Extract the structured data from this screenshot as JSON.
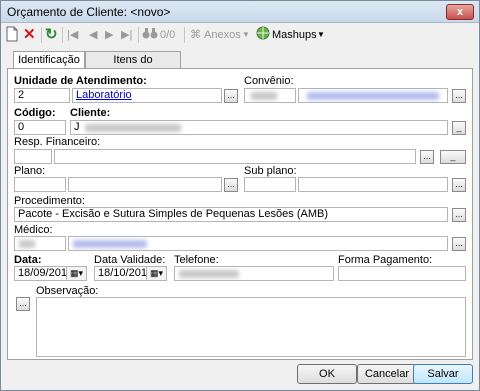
{
  "window": {
    "title": "Orçamento de Cliente: <novo>",
    "close": "x"
  },
  "toolbar": {
    "new_icon": "new-document-icon",
    "delete_icon": "delete-x-icon",
    "refresh_icon": "refresh-icon",
    "first_icon": "first-record-icon",
    "prev_icon": "previous-icon",
    "next_icon": "next-icon",
    "last_icon": "last-record-icon",
    "binoculars_icon": "binoculars-icon",
    "record_count": "0/0",
    "anexos": "Anexos",
    "mashups": "Mashups"
  },
  "tabs": {
    "identificacao": "Identificação",
    "itens": "Itens do Orçamento"
  },
  "form": {
    "unidade": {
      "label": "Unidade de Atendimento:",
      "code": "2",
      "name": "Laboratório"
    },
    "convenio": {
      "label": "Convênio:"
    },
    "codigo": {
      "label": "Código:",
      "value": "0"
    },
    "cliente": {
      "label": "Cliente:",
      "value_prefix": "J"
    },
    "resp_financeiro": {
      "label": "Resp. Financeiro:"
    },
    "plano": {
      "label": "Plano:"
    },
    "sub_plano": {
      "label": "Sub plano:"
    },
    "procedimento": {
      "label": "Procedimento:",
      "value": "Pacote - Excisão e Sutura Simples de Pequenas Lesões (AMB)"
    },
    "medico": {
      "label": "Médico:"
    },
    "data": {
      "label": "Data:",
      "value": "18/09/2015"
    },
    "data_validade": {
      "label": "Data Validade:",
      "value": "18/10/2015"
    },
    "telefone": {
      "label": "Telefone:"
    },
    "forma_pagamento": {
      "label": "Forma Pagamento:"
    },
    "observacao": {
      "label": "Observação:"
    },
    "ellipsis": "...",
    "clear": "_"
  },
  "buttons": {
    "ok": "OK",
    "cancelar": "Cancelar",
    "salvar": "Salvar"
  },
  "colors": {
    "link": "#0000cc",
    "redacted_link": "#b3bdf0",
    "redacted_gray": "#c8c8c8",
    "delete": "#d01818",
    "refresh": "#2e8b2e"
  }
}
